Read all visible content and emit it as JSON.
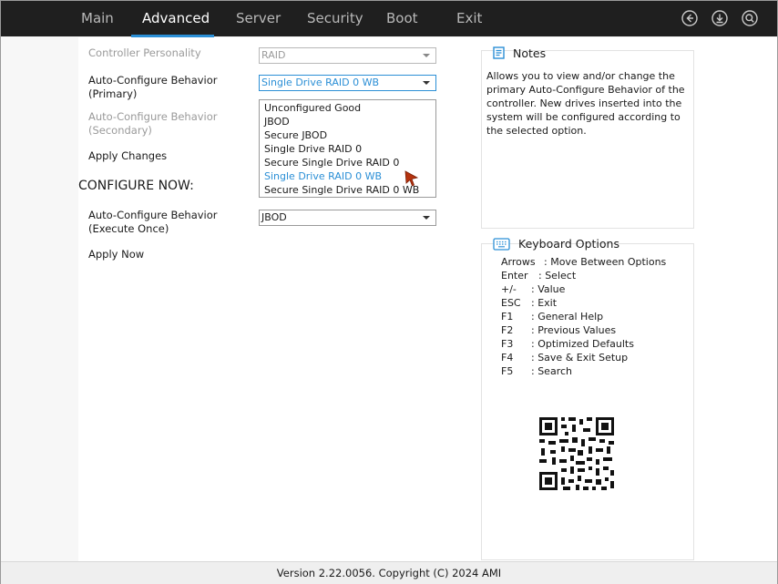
{
  "tabs": [
    {
      "label": "Main",
      "active": false
    },
    {
      "label": "Advanced",
      "active": true
    },
    {
      "label": "Server",
      "active": false
    },
    {
      "label": "Security",
      "active": false
    },
    {
      "label": "Boot",
      "active": false
    },
    {
      "label": "Exit",
      "active": false
    }
  ],
  "top_icons": [
    "back-icon",
    "save-download-icon",
    "search-icon"
  ],
  "settings": {
    "controller_personality": {
      "label": "Controller Personality",
      "value": "RAID"
    },
    "primary": {
      "label_line1": "Auto-Configure Behavior",
      "label_line2": "(Primary)",
      "value": "Single Drive RAID 0 WB"
    },
    "secondary": {
      "label_line1": "Auto-Configure Behavior",
      "label_line2": "(Secondary)"
    },
    "apply_changes": "Apply Changes",
    "configure_now": "CONFIGURE NOW:",
    "execute_once": {
      "label_line1": "Auto-Configure Behavior",
      "label_line2": "(Execute Once)",
      "value": "JBOD"
    },
    "apply_now": "Apply Now"
  },
  "dropdown": {
    "options": [
      "Unconfigured Good",
      "JBOD",
      "Secure JBOD",
      "Single Drive RAID 0",
      "Secure Single Drive RAID 0",
      "Single Drive RAID 0 WB",
      "Secure Single Drive RAID 0 WB"
    ],
    "selected": "Single Drive RAID 0 WB"
  },
  "notes": {
    "title": "Notes",
    "text": "Allows you to view and/or change the primary Auto-Configure Behavior of the controller. New drives inserted into the system will be configured according to the selected option."
  },
  "keyboard": {
    "title": "Keyboard Options",
    "keys": [
      {
        "key": "Arrows",
        "desc": ": Move Between Options"
      },
      {
        "key": "Enter",
        "desc": ": Select"
      },
      {
        "key": "+/-",
        "desc": ": Value"
      },
      {
        "key": "ESC",
        "desc": ": Exit"
      },
      {
        "key": "F1",
        "desc": ": General Help"
      },
      {
        "key": "F2",
        "desc": ": Previous Values"
      },
      {
        "key": "F3",
        "desc": ": Optimized Defaults"
      },
      {
        "key": "F4",
        "desc": ": Save & Exit Setup"
      },
      {
        "key": "F5",
        "desc": ": Search"
      }
    ]
  },
  "footer": "Version 2.22.0056. Copyright (C) 2024 AMI",
  "colors": {
    "accent": "#2b8fd6",
    "topbar": "#1f1f1f",
    "cursor": "#b5330f"
  }
}
